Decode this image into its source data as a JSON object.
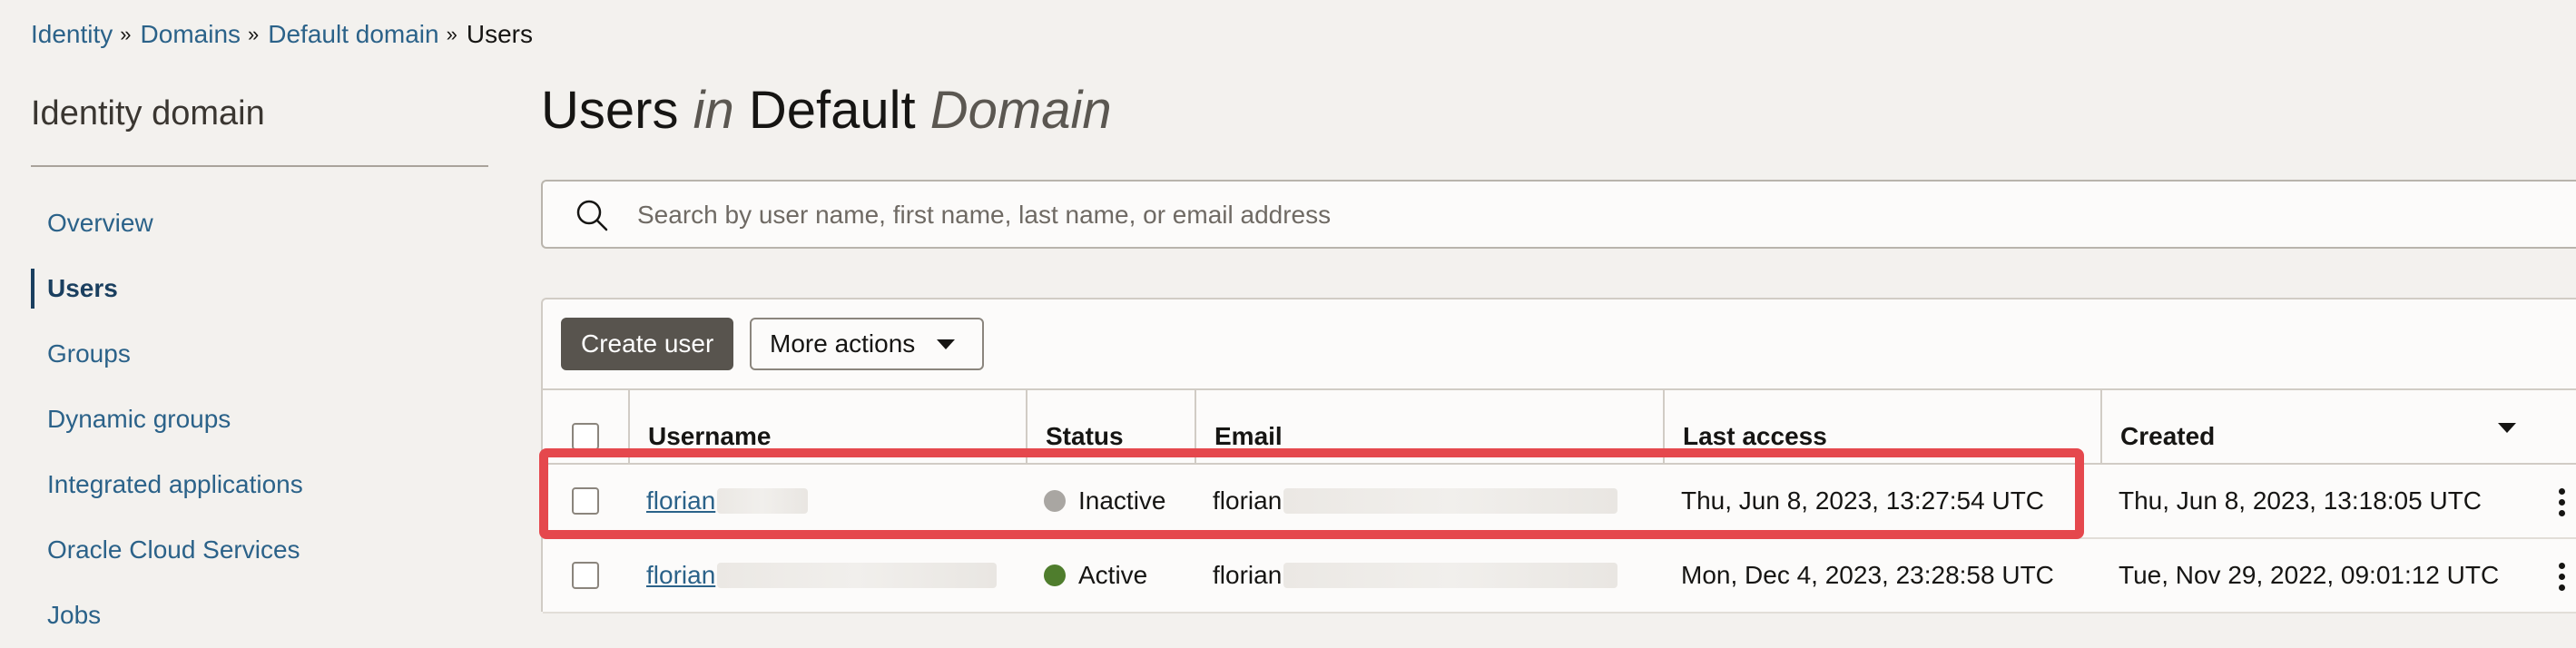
{
  "breadcrumb": {
    "items": [
      "Identity",
      "Domains",
      "Default domain"
    ],
    "current": "Users",
    "separator": "»"
  },
  "sidebar": {
    "heading": "Identity domain",
    "items": [
      {
        "label": "Overview",
        "active": false
      },
      {
        "label": "Users",
        "active": true
      },
      {
        "label": "Groups",
        "active": false
      },
      {
        "label": "Dynamic groups",
        "active": false
      },
      {
        "label": "Integrated applications",
        "active": false
      },
      {
        "label": "Oracle Cloud Services",
        "active": false
      },
      {
        "label": "Jobs",
        "active": false
      }
    ]
  },
  "title": {
    "part1": "Users",
    "part2": "in",
    "part3": "Default",
    "part4": "Domain"
  },
  "search": {
    "placeholder": "Search by user name, first name, last name, or email address",
    "value": ""
  },
  "toolbar": {
    "create_label": "Create user",
    "more_label": "More actions"
  },
  "table": {
    "columns": [
      "Username",
      "Status",
      "Email",
      "Last access",
      "Created"
    ],
    "sorted_column": "Created",
    "rows": [
      {
        "username": "florian",
        "status": "Inactive",
        "status_color": "#a9a6a2",
        "email": "florian",
        "last_access": "Thu, Jun 8, 2023, 13:27:54 UTC",
        "created": "Thu, Jun 8, 2023, 13:18:05 UTC",
        "highlighted": true
      },
      {
        "username": "florian",
        "status": "Active",
        "status_color": "#4f7d2d",
        "email": "florian",
        "last_access": "Mon, Dec 4, 2023, 23:28:58 UTC",
        "created": "Tue, Nov 29, 2022, 09:01:12 UTC",
        "highlighted": false
      }
    ]
  },
  "colors": {
    "link": "#2b6289",
    "highlight": "#e5484d",
    "primary_button": "#58544e"
  }
}
